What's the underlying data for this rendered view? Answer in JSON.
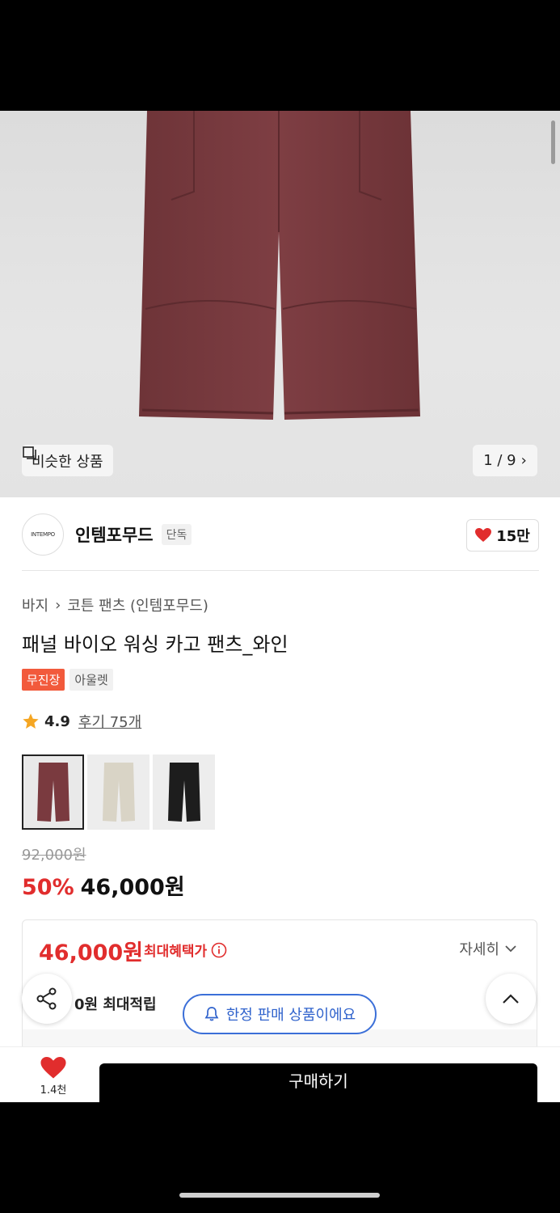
{
  "gallery": {
    "similar_label": "비슷한 상품",
    "page_indicator": "1 / 9"
  },
  "brand": {
    "logo_text": "INTEMPO",
    "name": "인템포무드",
    "badge": "단독",
    "likes": "15만"
  },
  "product": {
    "breadcrumb": [
      "바지",
      "코튼 팬츠 (인템포무드)"
    ],
    "title": "패널 바이오 워싱 카고 팬츠_와인",
    "tags": [
      "무진장",
      "아울렛"
    ],
    "rating": "4.9",
    "reviews": "후기 75개",
    "colors": [
      {
        "name": "wine",
        "hex": "#7a3a3f",
        "selected": true
      },
      {
        "name": "ivory",
        "hex": "#d9d4c6",
        "selected": false
      },
      {
        "name": "black",
        "hex": "#1d1d1d",
        "selected": false
      }
    ],
    "original_price": "92,000원",
    "discount": "50%",
    "sale_price": "46,000원"
  },
  "benefit": {
    "price": "46,000원",
    "label": "최대혜택가",
    "detail": "자세히",
    "points": "0원 최대적립"
  },
  "floating": {
    "limited_notice": "한정 판매 상품이에요"
  },
  "bottom_bar": {
    "like_count": "1.4천",
    "buy_label": "구매하기"
  },
  "colors": {
    "accent_red": "#e12d2d",
    "tag_red": "#f25a3c",
    "notice_blue": "#2f62cc"
  }
}
